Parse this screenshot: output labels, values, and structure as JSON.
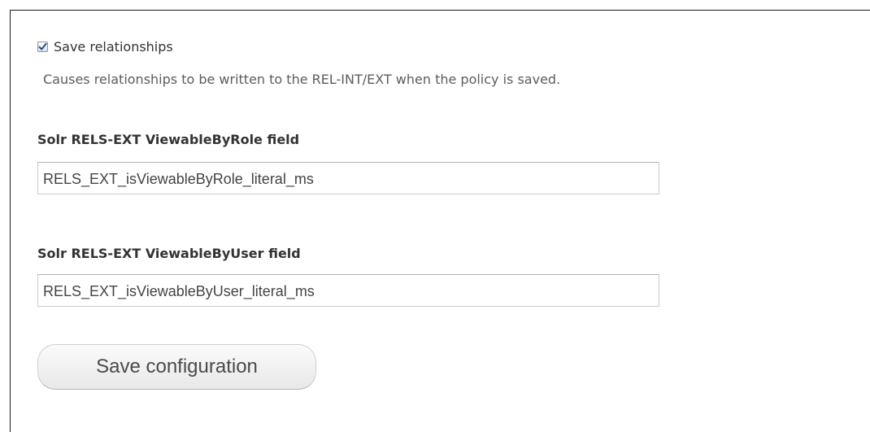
{
  "form": {
    "save_relationships": {
      "label": "Save relationships",
      "checked": true,
      "description": "Causes relationships to be written to the REL-INT/EXT when the policy is saved."
    },
    "viewable_by_role": {
      "label": "Solr RELS-EXT ViewableByRole field",
      "value": "RELS_EXT_isViewableByRole_literal_ms"
    },
    "viewable_by_user": {
      "label": "Solr RELS-EXT ViewableByUser field",
      "value": "RELS_EXT_isViewableByUser_literal_ms"
    },
    "save_button_label": "Save configuration"
  },
  "colors": {
    "checkmark": "#1c4f91",
    "frame_border": "#1a1a1a"
  },
  "icons": {
    "checkbox_check": "checkmark-icon"
  }
}
